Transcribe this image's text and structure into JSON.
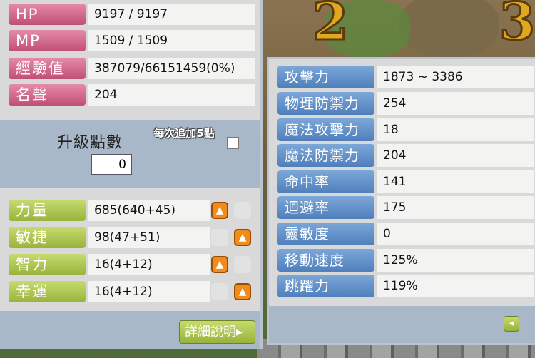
{
  "basic": [
    {
      "label": "HP",
      "value": "9197 / 9197"
    },
    {
      "label": "MP",
      "value": "1509 / 1509"
    },
    {
      "label": "經驗值",
      "value": "387079/66151459(0%)"
    },
    {
      "label": "名聲",
      "value": "204"
    }
  ],
  "ability_points": {
    "title": "升級點數",
    "value": "0",
    "auto_label": "每次追加5點"
  },
  "attributes": [
    {
      "label": "力量",
      "value": "685(640+45)"
    },
    {
      "label": "敏捷",
      "value": "98(47+51)"
    },
    {
      "label": "智力",
      "value": "16(4+12)"
    },
    {
      "label": "幸運",
      "value": "16(4+12)"
    }
  ],
  "detail_button": "詳細說明",
  "detail_arrow": "▸",
  "up_arrow": "▲",
  "back_arrow": "◂",
  "details": [
    {
      "label": "攻擊力",
      "value": "1873 ~ 3386"
    },
    {
      "label": "物理防禦力",
      "value": "254"
    },
    {
      "label": "魔法攻擊力",
      "value": "18"
    },
    {
      "label": "魔法防禦力",
      "value": "204"
    },
    {
      "label": "命中率",
      "value": "141"
    },
    {
      "label": "迴避率",
      "value": "175"
    },
    {
      "label": "靈敏度",
      "value": "0"
    },
    {
      "label": "移動速度",
      "value": "125%"
    },
    {
      "label": "跳躍力",
      "value": "119%"
    }
  ],
  "background": {
    "numbers": [
      "2",
      "3"
    ]
  }
}
